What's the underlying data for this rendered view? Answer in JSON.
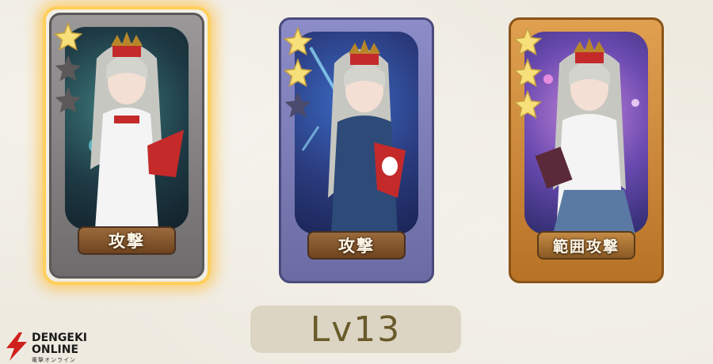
{
  "cards": [
    {
      "label": "攻撃",
      "stars_filled": 1,
      "stars_total": 3,
      "rarity_color": "#8a8888",
      "selected": true
    },
    {
      "label": "攻撃",
      "stars_filled": 2,
      "stars_total": 3,
      "rarity_color": "#7c7cb8",
      "selected": false
    },
    {
      "label": "範囲攻撃",
      "stars_filled": 3,
      "stars_total": 3,
      "rarity_color": "#d08a3a",
      "selected": false
    }
  ],
  "level": {
    "text": "Lv13"
  },
  "watermark": {
    "line1": "DENGEKI",
    "line2": "ONLINE",
    "line3": "電撃オンライン"
  },
  "colors": {
    "star_filled": "#f7e07a",
    "star_empty": "#5a5858",
    "selection_glow": "#ffcf5a"
  }
}
